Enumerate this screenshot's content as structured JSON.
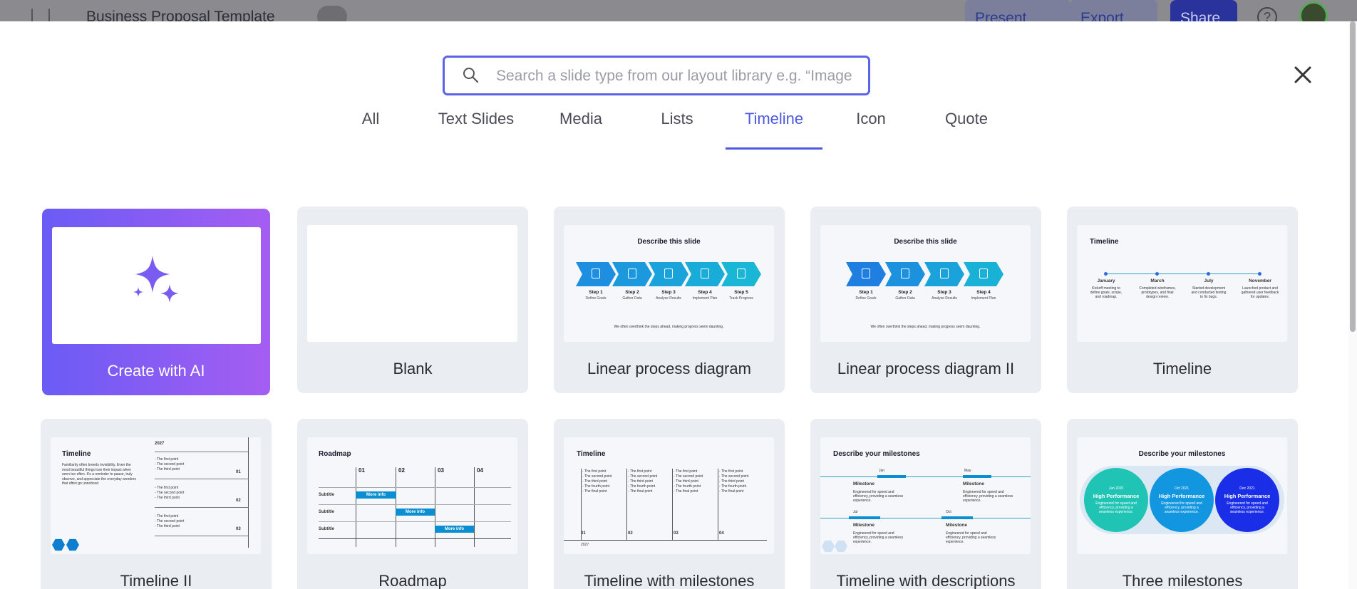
{
  "topbar": {
    "doc_title": "Business Proposal Template",
    "present_label": "Present",
    "export_label": "Export",
    "share_label": "Share",
    "help_label": "?"
  },
  "search": {
    "placeholder": "Search a slide type from our layout library e.g. “Image”"
  },
  "tabs": [
    {
      "label": "All",
      "active": false
    },
    {
      "label": "Text Slides",
      "active": false
    },
    {
      "label": "Media",
      "active": false
    },
    {
      "label": "Lists",
      "active": false
    },
    {
      "label": "Timeline",
      "active": true
    },
    {
      "label": "Icon",
      "active": false
    },
    {
      "label": "Quote",
      "active": false
    }
  ],
  "cards": [
    {
      "label": "Create with AI"
    },
    {
      "label": "Blank"
    },
    {
      "label": "Linear process diagram",
      "thumb_title": "Describe this slide",
      "steps": [
        {
          "name": "Step 1",
          "sub": "Define Goals"
        },
        {
          "name": "Step 2",
          "sub": "Gather Data"
        },
        {
          "name": "Step 3",
          "sub": "Analyze Results"
        },
        {
          "name": "Step 4",
          "sub": "Implement Plan"
        },
        {
          "name": "Step 5",
          "sub": "Track Progress"
        }
      ],
      "footer": "We often overthink the steps ahead, making progress seem daunting."
    },
    {
      "label": "Linear process diagram II",
      "thumb_title": "Describe this slide",
      "steps": [
        {
          "name": "Step 1",
          "sub": "Define Goals"
        },
        {
          "name": "Step 2",
          "sub": "Gather Data"
        },
        {
          "name": "Step 3",
          "sub": "Analyze Results"
        },
        {
          "name": "Step 4",
          "sub": "Implement Plan"
        }
      ],
      "footer": "We often overthink the steps ahead, making progress seem daunting."
    },
    {
      "label": "Timeline",
      "thumb_title": "Timeline",
      "months": [
        {
          "name": "January",
          "text": "Kickoff meeting to define goals, scope, and roadmap."
        },
        {
          "name": "March",
          "text": "Completed wireframes, prototypes, and final design review."
        },
        {
          "name": "July",
          "text": "Started development and conducted testing to fix bugs."
        },
        {
          "name": "November",
          "text": "Launched product and gathered user feedback for updates."
        }
      ]
    },
    {
      "label": "Timeline II",
      "thumb_title": "Timeline",
      "year": "2027",
      "body": "Familiarity often breeds invisibility. Even the most beautiful things lose their impact when seen too often. It's a reminder to pause, truly observe, and appreciate the everyday wonders that often go unnoticed.",
      "groups": [
        {
          "num": "01",
          "points": [
            "- The first point",
            "- The second point",
            "- The third point"
          ]
        },
        {
          "num": "02",
          "points": [
            "- The first point",
            "- The second point",
            "- The third point"
          ]
        },
        {
          "num": "03",
          "points": [
            "- The first point",
            "- The second point",
            "- The third point"
          ]
        }
      ]
    },
    {
      "label": "Roadmap",
      "thumb_title": "Roadmap",
      "columns": [
        "01",
        "02",
        "03",
        "04"
      ],
      "rows": [
        "Subtitle",
        "Subtitle",
        "Subtitle"
      ],
      "bar_label": "More info"
    },
    {
      "label": "Timeline with milestones",
      "thumb_title": "Timeline",
      "points": [
        "- The first point",
        "- The second point",
        "- The third point",
        "- The fourth point",
        "- The final point"
      ],
      "columns": [
        "01",
        "02",
        "03",
        "04"
      ],
      "year": "2027"
    },
    {
      "label": "Timeline with descriptions",
      "thumb_title": "Describe your milestones",
      "milestones": [
        {
          "date": "Jan",
          "name": "Milestone",
          "text": "Engineered for speed and efficiency, providing a seamless experience."
        },
        {
          "date": "May",
          "name": "Milestone",
          "text": "Engineered for speed and efficiency, providing a seamless experience."
        },
        {
          "date": "Jul",
          "name": "Milestone",
          "text": "Engineered for speed and efficiency, providing a seamless experience."
        },
        {
          "date": "Oct",
          "name": "Milestone",
          "text": "Engineered for speed and efficiency, providing a seamless experience."
        }
      ]
    },
    {
      "label": "Three milestones",
      "thumb_title": "Describe your milestones",
      "circles": [
        {
          "date": "Jan 2020",
          "title": "High Performance",
          "text": "Engineered for speed and efficiency, providing a seamless experience.",
          "color": "#1fc4b4"
        },
        {
          "date": "Oct 2021",
          "title": "High Performance",
          "text": "Engineered for speed and efficiency, providing a seamless experience.",
          "color": "#1296e0"
        },
        {
          "date": "Dec 2021",
          "title": "High Performance",
          "text": "Engineered for speed and efficiency, providing a seamless experience.",
          "color": "#1a2ee8"
        }
      ]
    }
  ],
  "colors": {
    "accent": "#4d5ae0",
    "chevron_start": "#1e8ee0",
    "chevron_end": "#19b6d6"
  }
}
